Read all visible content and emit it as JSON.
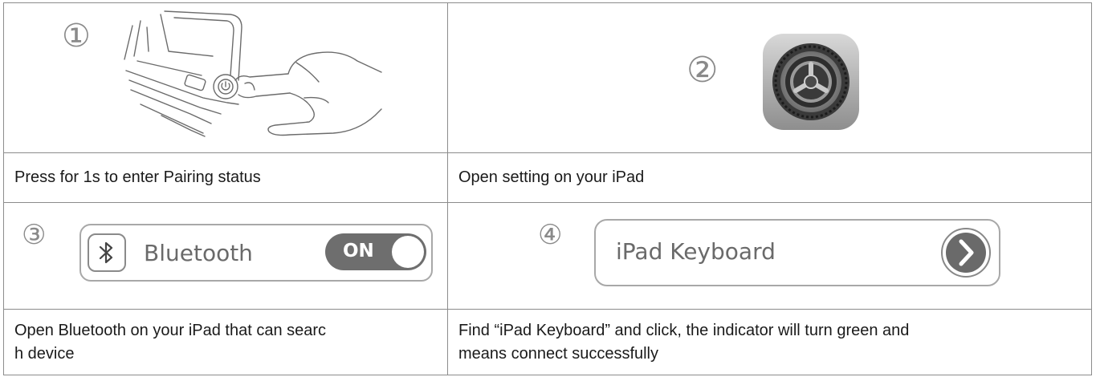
{
  "steps": [
    {
      "number": "①",
      "caption": "Press for 1s to enter Pairing status"
    },
    {
      "number": "②",
      "caption": "Open setting on your iPad"
    },
    {
      "number": "③",
      "caption_line1": "Open Bluetooth on your iPad that can searc",
      "caption_line2": "h device",
      "bluetooth_label": "Bluetooth",
      "toggle_label": "ON"
    },
    {
      "number": "④",
      "caption_line1": "Find “iPad Keyboard” and click, the indicator will turn green and",
      "caption_line2": "means connect successfully",
      "keyboard_label": "iPad Keyboard"
    }
  ],
  "icons": {
    "step1": "hand-pressing-power-icon",
    "step2": "settings-gear-icon",
    "step3": "bluetooth-icon",
    "step4": "chevron-right-icon"
  }
}
